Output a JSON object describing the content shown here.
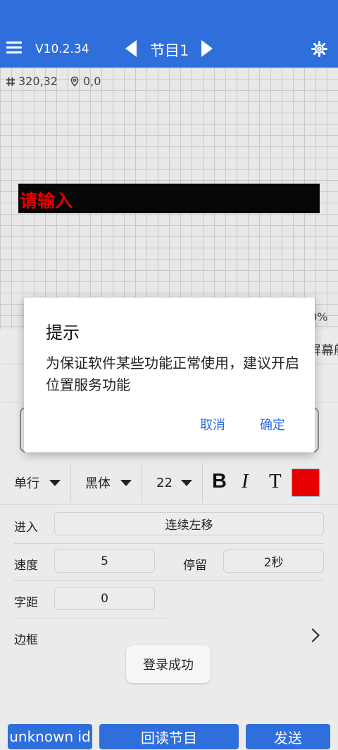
{
  "header": {
    "version": "V10.2.34",
    "program_title": "节目1"
  },
  "canvas": {
    "grid_coords": "320,32",
    "cursor_coords": "0,0",
    "led_text": "请输入",
    "led_text_color": "#e10000",
    "led_background": "#070707",
    "percent_fragment": "0%",
    "screen_label_fragment": "屏幕船"
  },
  "toolbar": {
    "line_mode": "单行",
    "font": "黑体",
    "font_size": "22",
    "bold_label": "B",
    "italic_label": "I",
    "text_label": "T",
    "text_color": "#e40000"
  },
  "properties": {
    "enter_label": "进入",
    "enter_value": "连续左移",
    "speed_label": "速度",
    "speed_value": "5",
    "stay_label": "停留",
    "stay_value": "2秒",
    "spacing_label": "字距",
    "spacing_value": "0",
    "border_label": "边框"
  },
  "toast": {
    "message": "登录成功"
  },
  "bottom_buttons": {
    "left": "unknown id",
    "readback": "回读节目",
    "send": "发送"
  },
  "dialog": {
    "title": "提示",
    "message": "为保证软件某些功能正常使用，建议开启位置服务功能",
    "cancel": "取消",
    "confirm": "确定"
  },
  "colors": {
    "accent": "#2f6fdb"
  }
}
